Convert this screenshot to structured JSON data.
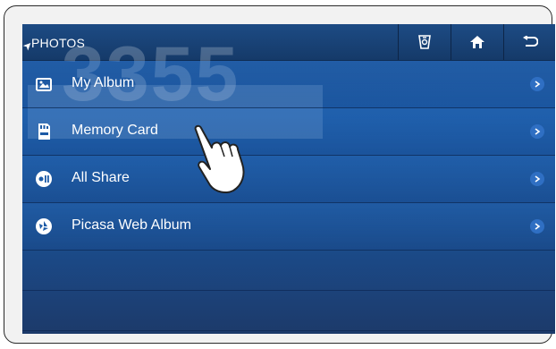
{
  "header": {
    "title": "PHOTOS",
    "buttons": [
      {
        "name": "media-mode-icon"
      },
      {
        "name": "home-icon"
      },
      {
        "name": "back-icon"
      }
    ]
  },
  "watermark": "3355",
  "menu": {
    "items": [
      {
        "label": "My Album",
        "icon": "album-icon"
      },
      {
        "label": "Memory Card",
        "icon": "memory-card-icon"
      },
      {
        "label": "All Share",
        "icon": "allshare-icon"
      },
      {
        "label": "Picasa Web Album",
        "icon": "picasa-icon"
      }
    ]
  },
  "colors": {
    "screen_bg": "#1c5aa6",
    "topbar_bg": "#1d4b84",
    "chevron_bg": "#2f6fc3",
    "text": "#ffffff"
  }
}
